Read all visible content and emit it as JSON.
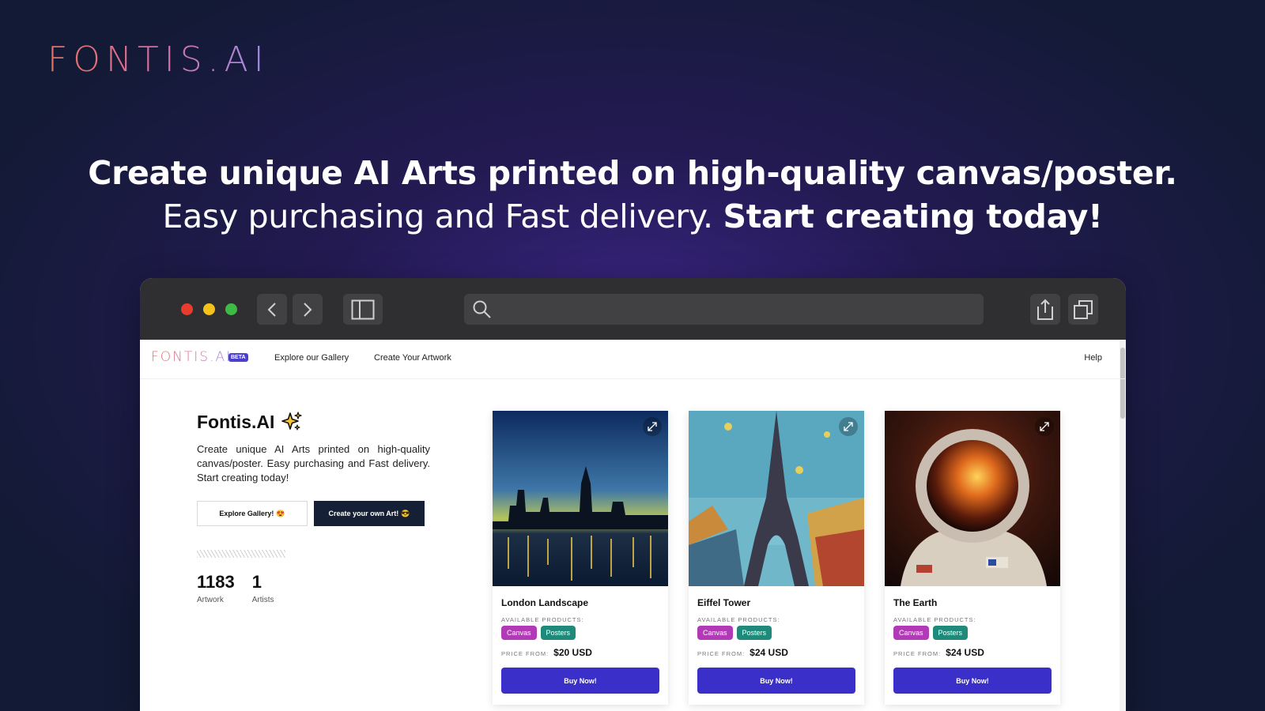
{
  "hero": {
    "brand": "FONTIS.AI",
    "line1": "Create unique AI Arts printed on high-quality canvas/poster.",
    "line2_normal": "Easy purchasing and Fast delivery.",
    "line2_bold": "Start creating today!"
  },
  "site": {
    "logo": "FONTIS.AI",
    "badge": "BETA",
    "nav": {
      "explore": "Explore our Gallery",
      "create": "Create Your Artwork",
      "help": "Help"
    }
  },
  "intro": {
    "title": "Fontis.AI",
    "description": "Create unique AI Arts printed on high-quality canvas/poster. Easy purchasing and Fast delivery. Start creating today!",
    "explore_button": "Explore Gallery!",
    "explore_emoji": "😍",
    "create_button": "Create your own Art!",
    "create_emoji": "😎"
  },
  "stats": [
    {
      "value": "1183",
      "label": "Artwork"
    },
    {
      "value": "1",
      "label": "Artists"
    }
  ],
  "cards": [
    {
      "title": "London Landscape",
      "available_label": "AVAILABLE PRODUCTS:",
      "tag1": "Canvas",
      "tag2": "Posters",
      "price_label": "PRICE FROM:",
      "price": "$20 USD",
      "buy": "Buy Now!"
    },
    {
      "title": "Eiffel Tower",
      "available_label": "AVAILABLE PRODUCTS:",
      "tag1": "Canvas",
      "tag2": "Posters",
      "price_label": "PRICE FROM:",
      "price": "$24 USD",
      "buy": "Buy Now!"
    },
    {
      "title": "The Earth",
      "available_label": "AVAILABLE PRODUCTS:",
      "tag1": "Canvas",
      "tag2": "Posters",
      "price_label": "PRICE FROM:",
      "price": "$24 USD",
      "buy": "Buy Now!"
    }
  ],
  "colors": {
    "accent": "#3b2fc9",
    "tag_canvas": "#b23ab7",
    "tag_posters": "#1f8a7a",
    "dark_button": "#152036"
  },
  "icons": [
    "back-arrow-icon",
    "forward-arrow-icon",
    "sidebar-icon",
    "search-icon",
    "share-icon",
    "tabs-icon",
    "expand-icon",
    "sparkles-icon"
  ]
}
